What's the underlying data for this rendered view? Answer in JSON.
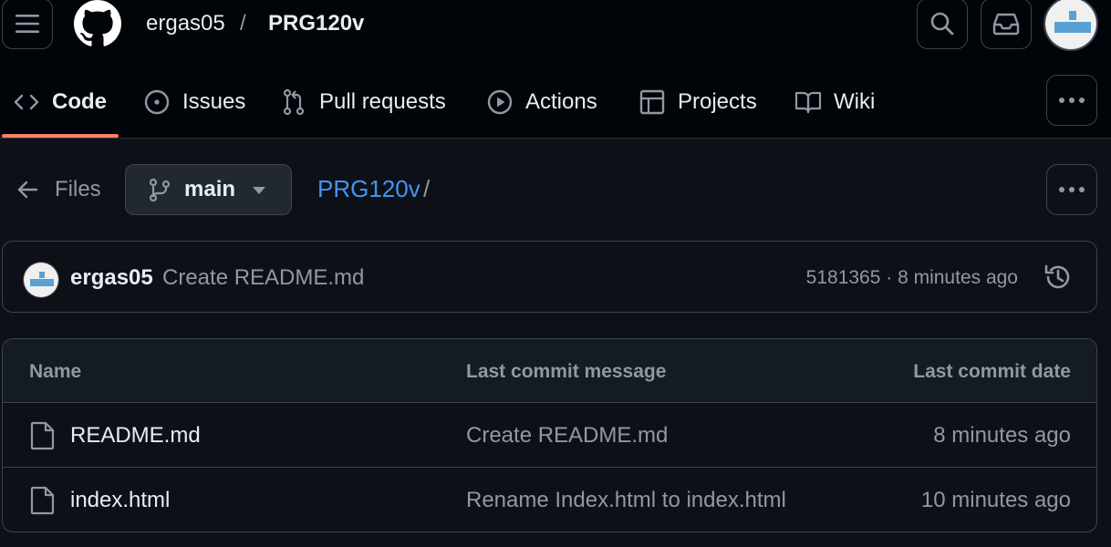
{
  "header": {
    "owner": "ergas05",
    "separator": "/",
    "repo": "PRG120v",
    "icons": [
      "menu-icon",
      "github-logo-icon",
      "search-icon",
      "inbox-icon",
      "avatar"
    ]
  },
  "nav": {
    "tabs": [
      {
        "label": "Code",
        "icon": "code-icon",
        "selected": true
      },
      {
        "label": "Issues",
        "icon": "issue-opened-icon"
      },
      {
        "label": "Pull requests",
        "icon": "git-pull-request-icon"
      },
      {
        "label": "Actions",
        "icon": "play-icon"
      },
      {
        "label": "Projects",
        "icon": "table-icon"
      },
      {
        "label": "Wiki",
        "icon": "book-icon"
      }
    ],
    "more_icon": "kebab-horizontal-icon"
  },
  "files_nav": {
    "back_label": "Files",
    "branch": "main",
    "path_repo": "PRG120v",
    "path_sep": "/"
  },
  "commit": {
    "author": "ergas05",
    "message": "Create README.md",
    "meta": "5181365 · 8 minutes ago",
    "history_icon": "history-icon"
  },
  "table": {
    "headers": [
      "Name",
      "Last commit message",
      "Last commit date"
    ],
    "rows": [
      {
        "name": "README.md",
        "message": "Create README.md",
        "date": "8 minutes ago"
      },
      {
        "name": "index.html",
        "message": "Rename Index.html to index.html",
        "date": "10 minutes ago"
      }
    ]
  },
  "colors": {
    "background": "#0d1117",
    "header_bg": "#010409",
    "border": "#3d444d",
    "link": "#4493f8",
    "tab_underline": "#f78166",
    "muted_text": "#9198a1",
    "text": "#e6edf3"
  }
}
